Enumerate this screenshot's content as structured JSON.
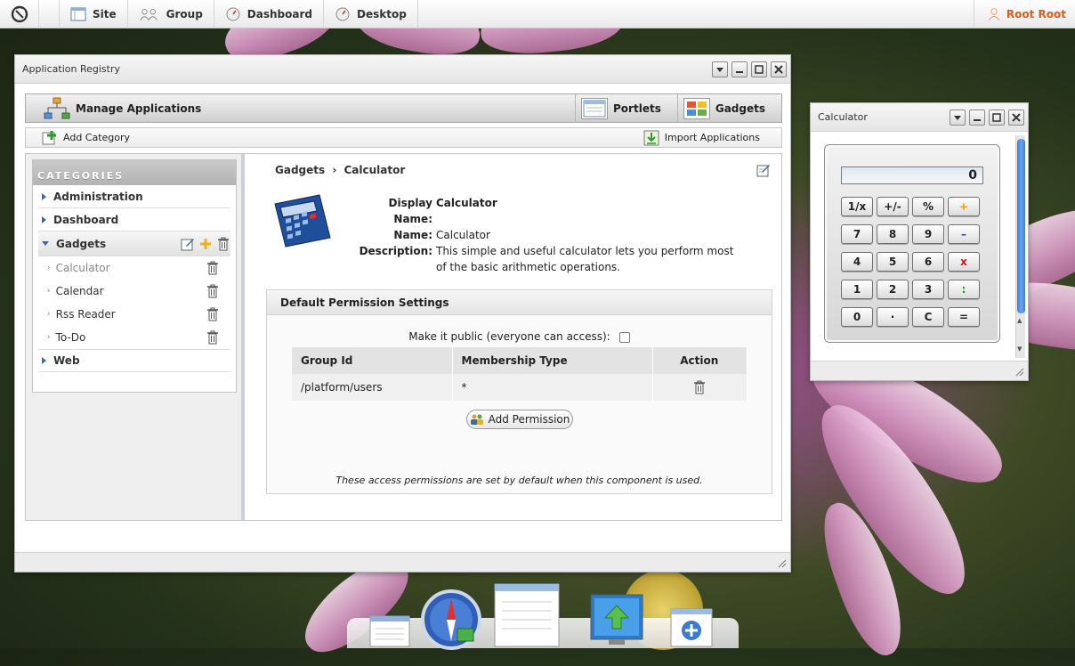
{
  "topbar": {
    "nav": [
      {
        "label": "Site",
        "icon": "site-icon"
      },
      {
        "label": "Group",
        "icon": "group-icon"
      },
      {
        "label": "Dashboard",
        "icon": "dashboard-icon"
      },
      {
        "label": "Desktop",
        "icon": "desktop-icon"
      }
    ],
    "user": "Root Root"
  },
  "app_registry": {
    "title": "Application Registry",
    "toolbar": {
      "main": "Manage Applications",
      "tabs": [
        "Portlets",
        "Gadgets"
      ]
    },
    "actions": {
      "add_category": "Add Category",
      "import": "Import Applications"
    },
    "categories_header": "CATEGORIES",
    "categories": [
      {
        "label": "Administration"
      },
      {
        "label": "Dashboard"
      },
      {
        "label": "Gadgets"
      },
      {
        "label": "Web"
      }
    ],
    "gadgets": [
      "Calculator",
      "Calendar",
      "Rss Reader",
      "To-Do"
    ],
    "breadcrumb": {
      "parent": "Gadgets",
      "sep": "›",
      "current": "Calculator"
    },
    "details": {
      "display_name_label": "Display Name:",
      "display_name": "Calculator",
      "name_label": "Name:",
      "name": "Calculator",
      "description_label": "Description:",
      "description": "This simple and useful calculator lets you perform most of the basic arithmetic operations."
    },
    "permissions": {
      "title": "Default Permission Settings",
      "public_label": "Make it public (everyone can access):",
      "columns": [
        "Group Id",
        "Membership Type",
        "Action"
      ],
      "rows": [
        {
          "group": "/platform/users",
          "membership": "*"
        }
      ],
      "add_button": "Add Permission",
      "note": "These access permissions are set by default when this component is used."
    }
  },
  "calculator": {
    "title": "Calculator",
    "display": "0",
    "keys": [
      "1/x",
      "+/-",
      "%",
      "+",
      "7",
      "8",
      "9",
      "–",
      "4",
      "5",
      "6",
      "x",
      "1",
      "2",
      "3",
      ":",
      "0",
      "·",
      "C",
      "="
    ],
    "colors": {
      "plus": "#f0a000",
      "minus": "#1f3fd6",
      "times": "#e01010",
      "divide": "#2c9a2c"
    }
  },
  "colors": {
    "accent": "#3c6aa0",
    "user": "#e05b1a"
  }
}
